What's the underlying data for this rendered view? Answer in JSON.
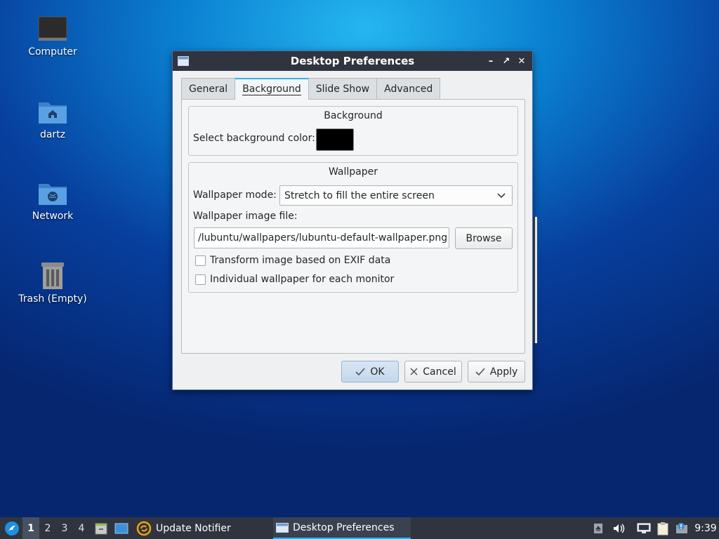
{
  "desktop": {
    "icons": [
      {
        "label": "Computer",
        "icon": "computer-icon"
      },
      {
        "label": "dartz",
        "icon": "home-folder-icon"
      },
      {
        "label": "Network",
        "icon": "network-folder-icon"
      },
      {
        "label": "Trash (Empty)",
        "icon": "trash-icon"
      }
    ]
  },
  "window": {
    "title": "Desktop Preferences",
    "tabs": [
      {
        "label": "General",
        "active": false
      },
      {
        "label": "Background",
        "active": true
      },
      {
        "label": "Slide Show",
        "active": false
      },
      {
        "label": "Advanced",
        "active": false
      }
    ],
    "background_group": {
      "title": "Background",
      "color_label": "Select background color:",
      "color_value": "#000000"
    },
    "wallpaper_group": {
      "title": "Wallpaper",
      "mode_label": "Wallpaper mode:",
      "mode_value": "Stretch to fill the entire screen",
      "file_label": "Wallpaper image file:",
      "file_value": "/lubuntu/wallpapers/lubuntu-default-wallpaper.png",
      "browse_label": "Browse",
      "exif_label": "Transform image based on EXIF data",
      "exif_checked": false,
      "per_monitor_label": "Individual wallpaper for each monitor",
      "per_monitor_checked": false
    },
    "buttons": {
      "ok": "OK",
      "cancel": "Cancel",
      "apply": "Apply"
    }
  },
  "taskbar": {
    "desktops": [
      "1",
      "2",
      "3",
      "4"
    ],
    "active_desktop": "1",
    "tasks": [
      {
        "label": "Update Notifier",
        "active": false
      },
      {
        "label": "Desktop Preferences",
        "active": true
      }
    ],
    "clock": "9:39"
  },
  "colors": {
    "accent": "#3daee9",
    "titlebar": "#2f343f",
    "taskbar": "#2f343f"
  }
}
